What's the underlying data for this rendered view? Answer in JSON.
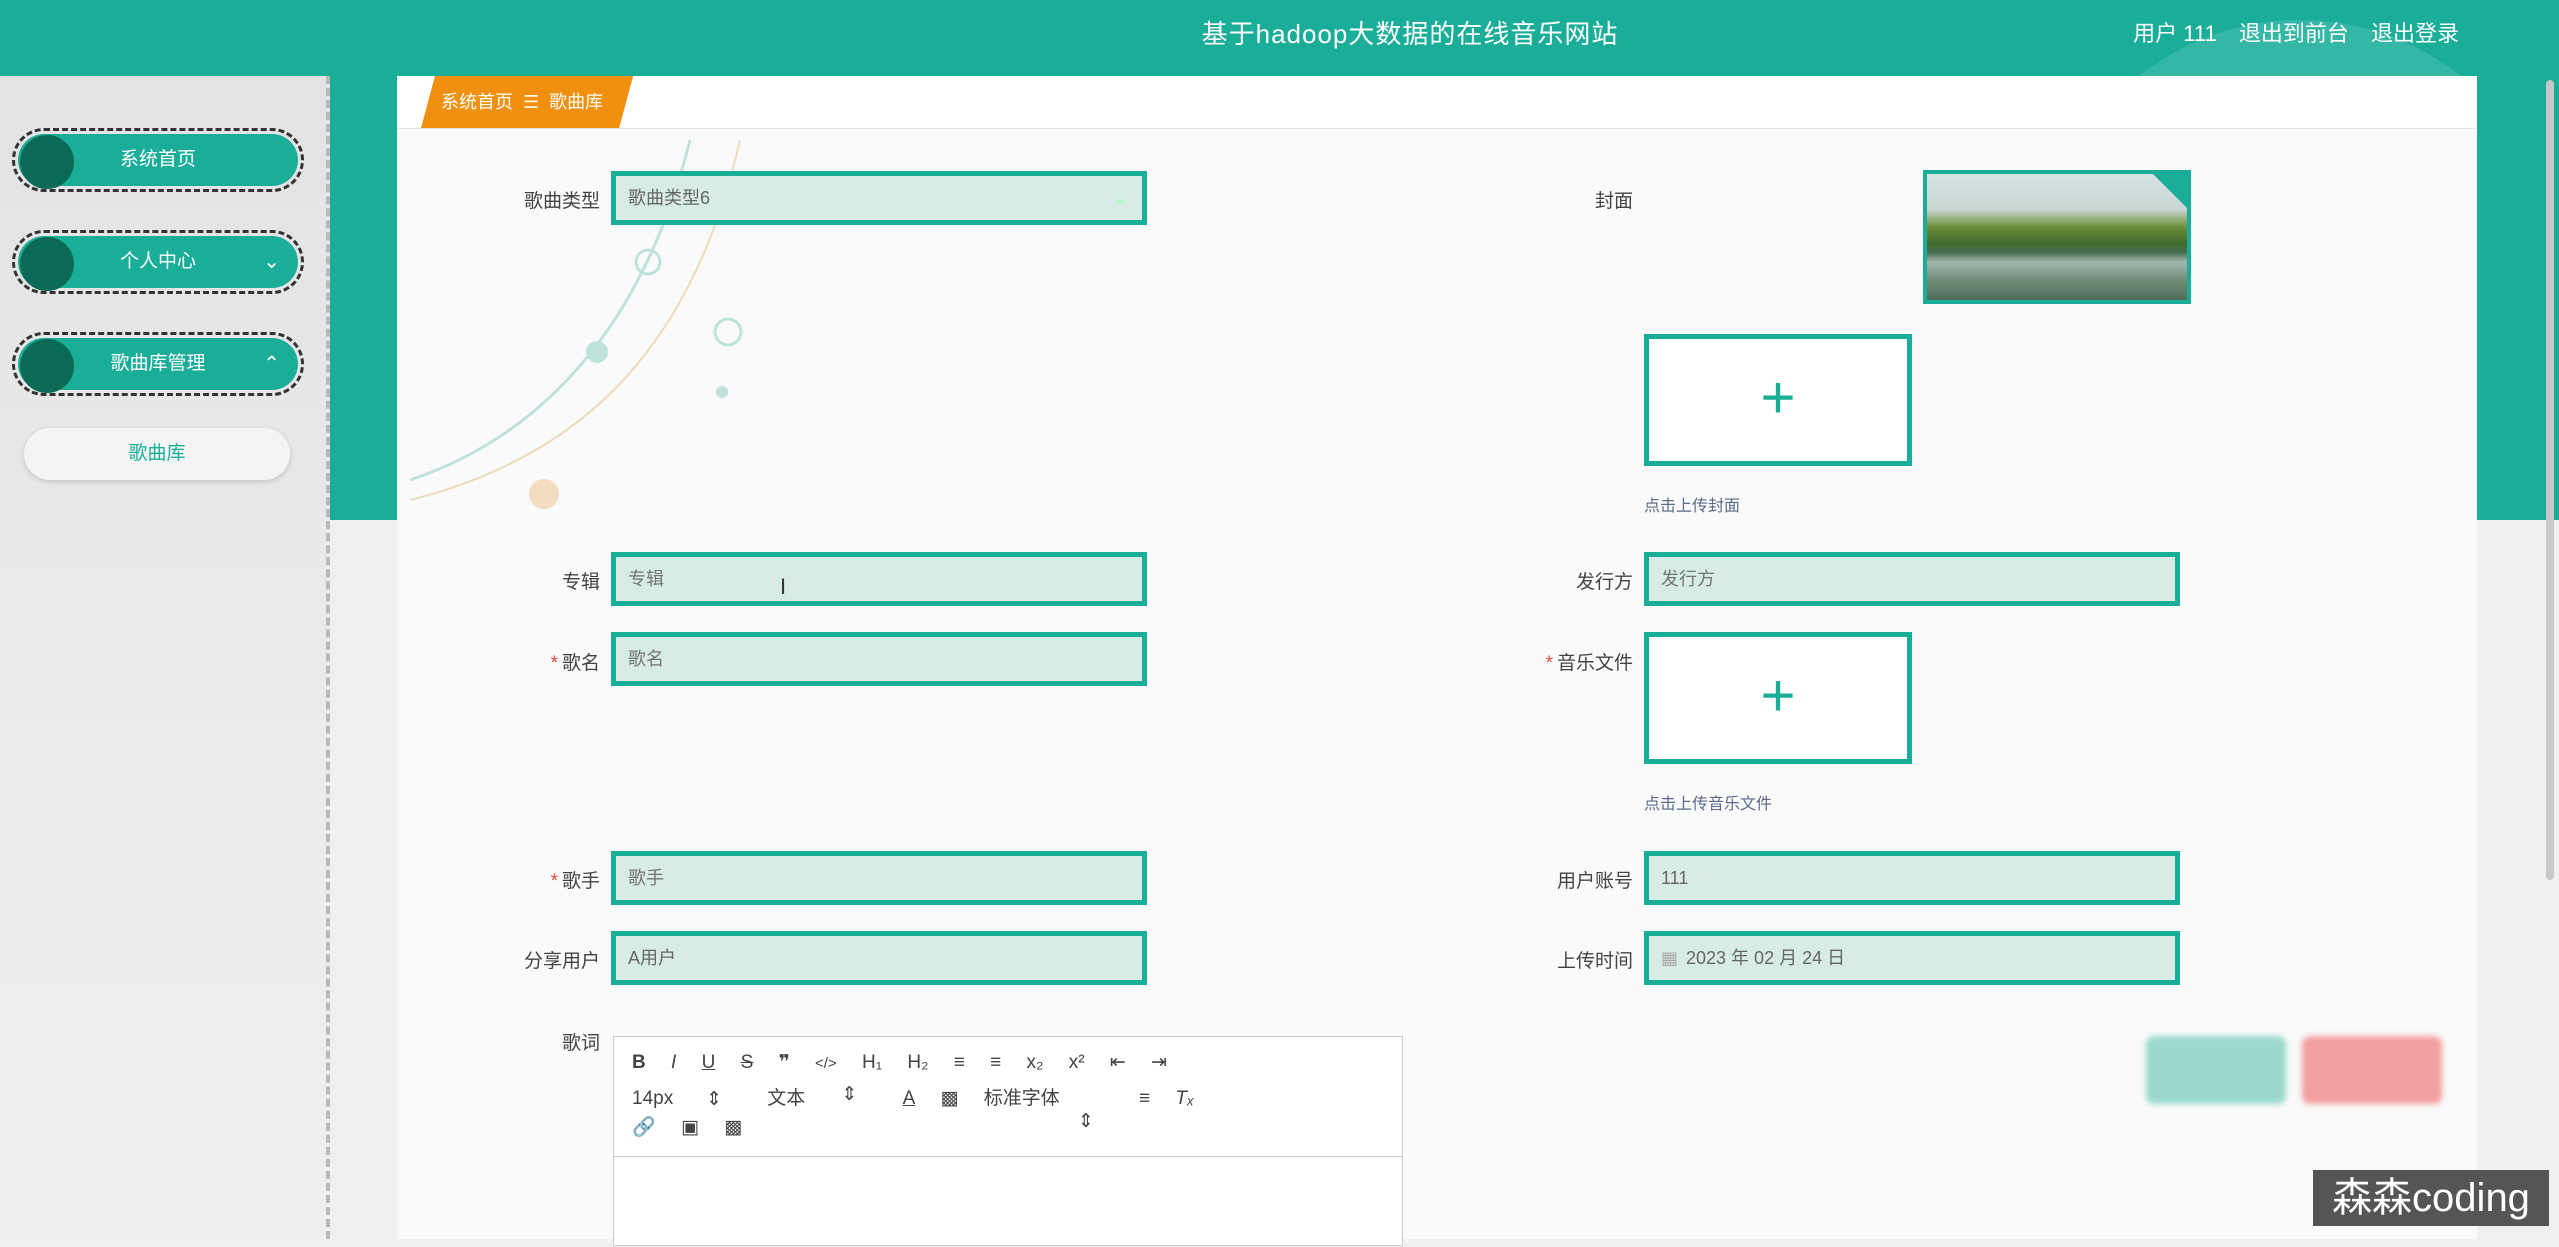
{
  "header": {
    "title": "基于hadoop大数据的在线音乐网站",
    "user": "用户 111",
    "to_frontend": "退出到前台",
    "logout": "退出登录"
  },
  "sidebar": {
    "items": [
      {
        "label": "系统首页"
      },
      {
        "label": "个人中心",
        "chevron": "chevron-down-icon"
      },
      {
        "label": "歌曲库管理",
        "chevron": "chevron-up-icon"
      }
    ],
    "submenu": [
      {
        "label": "歌曲库"
      }
    ]
  },
  "breadcrumb": {
    "home": "系统首页",
    "separator": "☰",
    "current": "歌曲库"
  },
  "form": {
    "song_type": {
      "label": "歌曲类型",
      "value": "歌曲类型6"
    },
    "cover": {
      "label": "封面",
      "hint": "点击上传封面"
    },
    "album": {
      "label": "专辑",
      "placeholder": "专辑"
    },
    "publisher": {
      "label": "发行方",
      "placeholder": "发行方"
    },
    "song_name": {
      "label": "歌名",
      "placeholder": "歌名",
      "required": "*"
    },
    "music_file": {
      "label": "音乐文件",
      "hint": "点击上传音乐文件",
      "required": "*"
    },
    "singer": {
      "label": "歌手",
      "placeholder": "歌手",
      "required": "*"
    },
    "user_account": {
      "label": "用户账号",
      "value": "111"
    },
    "share_user": {
      "label": "分享用户",
      "value": "A用户"
    },
    "upload_time": {
      "label": "上传时间",
      "value": "2023 年 02 月 24 日"
    },
    "lyrics": {
      "label": "歌词"
    }
  },
  "editor": {
    "font_size": "14px",
    "paragraph": "文本",
    "font_family": "标准字体"
  },
  "upload_plus": "+",
  "watermark": "森森coding",
  "colors": {
    "primary": "#1aae99",
    "accent": "#f0900e",
    "danger": "#e74c3c"
  }
}
